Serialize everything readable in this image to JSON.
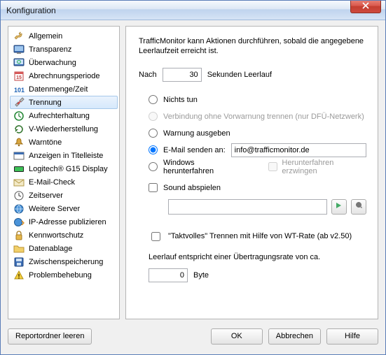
{
  "window": {
    "title": "Konfiguration"
  },
  "sidebar": {
    "items": [
      {
        "label": "Allgemein"
      },
      {
        "label": "Transparenz"
      },
      {
        "label": "Überwachung"
      },
      {
        "label": "Abrechnungsperiode"
      },
      {
        "label": "Datenmenge/Zeit"
      },
      {
        "label": "Trennung"
      },
      {
        "label": "Aufrechterhaltung"
      },
      {
        "label": "V-Wiederherstellung"
      },
      {
        "label": "Warntöne"
      },
      {
        "label": "Anzeigen in Titelleiste"
      },
      {
        "label": "Logitech® G15 Display"
      },
      {
        "label": "E-Mail-Check"
      },
      {
        "label": "Zeitserver"
      },
      {
        "label": "Weitere Server"
      },
      {
        "label": "IP-Adresse publizieren"
      },
      {
        "label": "Kennwortschutz"
      },
      {
        "label": "Datenablage"
      },
      {
        "label": "Zwischenspeicherung"
      },
      {
        "label": "Problembehebung"
      }
    ],
    "selected_index": 5
  },
  "content": {
    "intro": "TrafficMonitor kann Aktionen durchführen, sobald die angegebene Leerlaufzeit erreicht ist.",
    "after_label": "Nach",
    "after_seconds": "30",
    "after_unit": "Sekunden Leerlauf",
    "options": {
      "nothing": "Nichts tun",
      "disconnect_no_warning": "Verbindung ohne Vorwarnung trennen (nur DFÜ-Netzwerk)",
      "warn": "Warnung ausgeben",
      "email": "E-Mail senden an:",
      "email_value": "info@trafficmonitor.de",
      "shutdown": "Windows herunterfahren",
      "force_shutdown": "Herunterfahren erzwingen",
      "play_sound": "Sound abspielen",
      "sound_path": ""
    },
    "tactful": "\"Taktvolles\" Trennen mit Hilfe von WT-Rate (ab v2.50)",
    "idle_equiv": "Leerlauf entspricht einer Übertragungsrate von ca.",
    "byte_value": "0",
    "byte_unit": "Byte"
  },
  "footer": {
    "report": "Reportordner leeren",
    "ok": "OK",
    "cancel": "Abbrechen",
    "help": "Hilfe"
  }
}
